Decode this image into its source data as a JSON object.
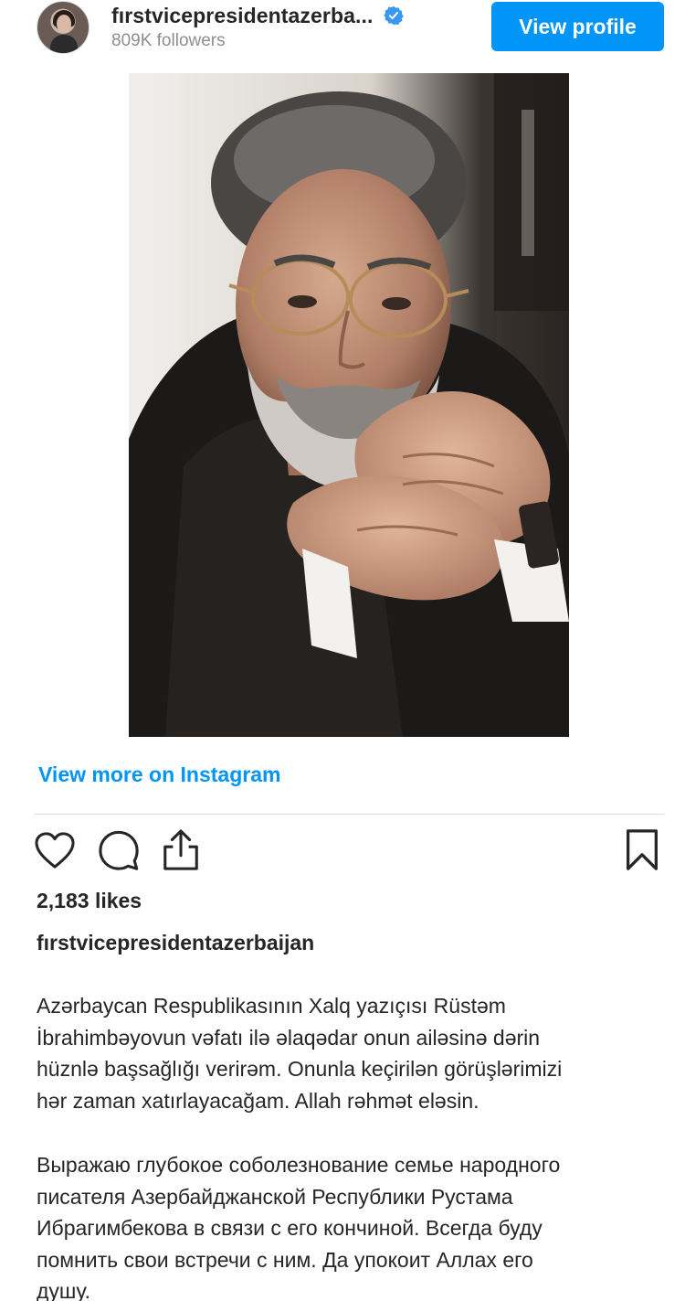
{
  "header": {
    "username": "fırstvicepresidentazerba...",
    "followers": "809K followers",
    "view_profile_label": "View profile",
    "avatar_icon": "profile-avatar",
    "verified_icon": "verified-badge-icon",
    "accent_color": "#0095f6"
  },
  "post": {
    "image_description_icon": "portrait-photo",
    "view_more_label": "View more on Instagram",
    "actions": {
      "like_icon": "heart-icon",
      "comment_icon": "comment-icon",
      "share_icon": "share-icon",
      "save_icon": "bookmark-icon"
    },
    "likes": "2,183 likes",
    "caption_username": "fırstvicepresidentazerbaijan",
    "caption_az": "Azərbaycan Respublikasının Xalq yazıçısı Rüstəm\nİbrahimbəyovun vəfatı ilə əlaqədar onun ailəsinə dərin\nhüznlə başsağlığı verirəm. Onunla keçirilən görüşlərimizi\nhər zaman xatırlayacağam. Allah rəhmət eləsin.",
    "caption_ru": "Выражаю глубокое соболезнование семье народного\nписателя Азербайджанской Республики Рустама\nИбрагимбекова в связи с его кончиной. Всегда буду\nпомнить свои встречи с ним. Да упокоит Аллах его\nдушу."
  }
}
